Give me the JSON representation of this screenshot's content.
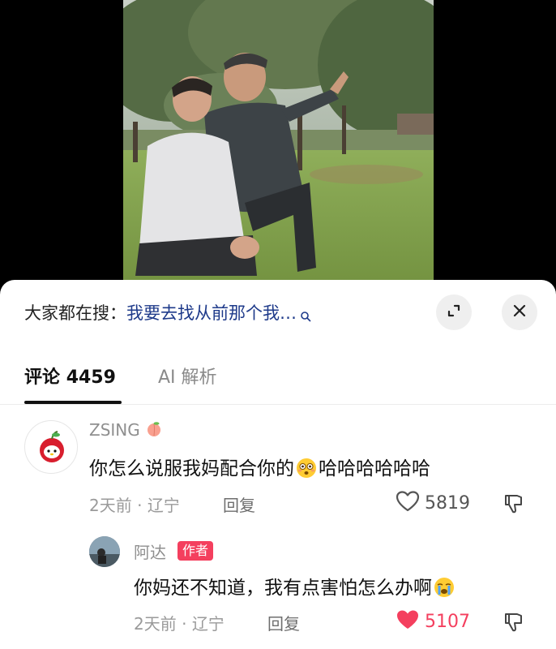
{
  "search": {
    "prefix": "大家都在搜：",
    "term": "我要去找从前那个我…"
  },
  "tabs": {
    "comments_label": "评论",
    "comments_count": "4459",
    "ai_label": "AI 解析"
  },
  "comments": [
    {
      "username": "ZSING",
      "username_emoji": "peach-emoji",
      "text_before": "你怎么说服我妈配合你的",
      "emoji": "flushed-face-emoji",
      "text_after": "哈哈哈哈哈哈",
      "time": "2天前",
      "location": "辽宁",
      "reply_label": "回复",
      "likes": "5819",
      "liked": false
    }
  ],
  "replies": [
    {
      "username": "阿达",
      "badge": "作者",
      "text": "你妈还不知道，我有点害怕怎么办啊",
      "emoji": "crying-face-emoji",
      "time": "2天前",
      "location": "辽宁",
      "reply_label": "回复",
      "likes": "5107",
      "liked": true
    }
  ],
  "colors": {
    "accent_like": "#f43f5e",
    "search_term": "#1e3a8a",
    "sheet_bg": "#ffffff",
    "video_bg": "#000000"
  }
}
